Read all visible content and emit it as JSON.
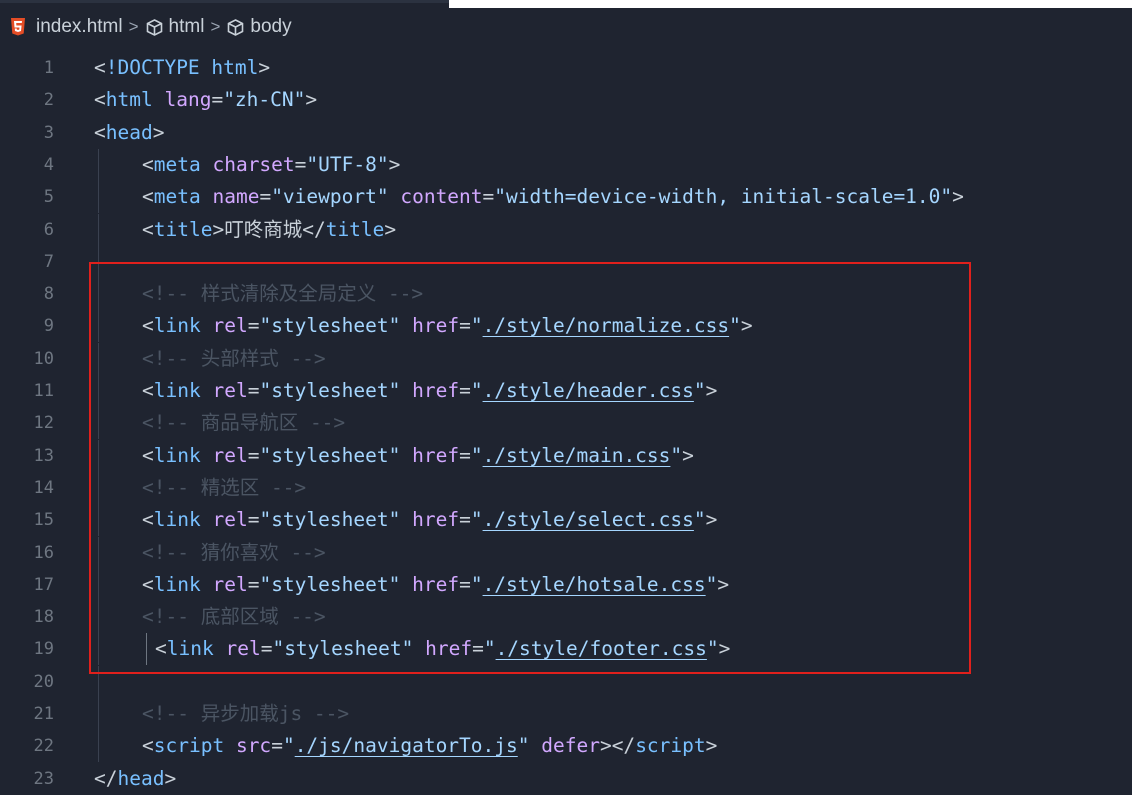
{
  "breadcrumb": {
    "file": "index.html",
    "items": [
      "html",
      "body"
    ],
    "separator": ">"
  },
  "lines": [
    {
      "n": "1",
      "indent": 0,
      "parts": [
        [
          "punc",
          "<"
        ],
        [
          "tag",
          "!DOCTYPE html"
        ],
        [
          "punc",
          ">"
        ]
      ]
    },
    {
      "n": "2",
      "indent": 0,
      "parts": [
        [
          "punc",
          "<"
        ],
        [
          "tag",
          "html"
        ],
        [
          "punc",
          " "
        ],
        [
          "attr",
          "lang"
        ],
        [
          "punc",
          "="
        ],
        [
          "str",
          "\"zh-CN\""
        ],
        [
          "punc",
          ">"
        ]
      ]
    },
    {
      "n": "3",
      "indent": 0,
      "parts": [
        [
          "punc",
          "<"
        ],
        [
          "tag",
          "head"
        ],
        [
          "punc",
          ">"
        ]
      ]
    },
    {
      "n": "4",
      "indent": 1,
      "parts": [
        [
          "punc",
          "<"
        ],
        [
          "tag",
          "meta"
        ],
        [
          "punc",
          " "
        ],
        [
          "attr",
          "charset"
        ],
        [
          "punc",
          "="
        ],
        [
          "str",
          "\"UTF-8\""
        ],
        [
          "punc",
          ">"
        ]
      ]
    },
    {
      "n": "5",
      "indent": 1,
      "parts": [
        [
          "punc",
          "<"
        ],
        [
          "tag",
          "meta"
        ],
        [
          "punc",
          " "
        ],
        [
          "attr",
          "name"
        ],
        [
          "punc",
          "="
        ],
        [
          "str",
          "\"viewport\""
        ],
        [
          "punc",
          " "
        ],
        [
          "attr",
          "content"
        ],
        [
          "punc",
          "="
        ],
        [
          "str",
          "\"width=device-width, initial-scale=1.0\""
        ],
        [
          "punc",
          ">"
        ]
      ]
    },
    {
      "n": "6",
      "indent": 1,
      "parts": [
        [
          "punc",
          "<"
        ],
        [
          "tag",
          "title"
        ],
        [
          "punc",
          ">"
        ],
        [
          "punc",
          "叮咚商城"
        ],
        [
          "punc",
          "</"
        ],
        [
          "tag",
          "title"
        ],
        [
          "punc",
          ">"
        ]
      ]
    },
    {
      "n": "7",
      "indent": 0,
      "parts": []
    },
    {
      "n": "8",
      "indent": 1,
      "parts": [
        [
          "comment",
          "<!-- 样式清除及全局定义 -->"
        ]
      ]
    },
    {
      "n": "9",
      "indent": 1,
      "parts": [
        [
          "punc",
          "<"
        ],
        [
          "tag",
          "link"
        ],
        [
          "punc",
          " "
        ],
        [
          "attr",
          "rel"
        ],
        [
          "punc",
          "="
        ],
        [
          "str",
          "\"stylesheet\""
        ],
        [
          "punc",
          " "
        ],
        [
          "attr",
          "href"
        ],
        [
          "punc",
          "="
        ],
        [
          "str",
          "\""
        ],
        [
          "link",
          "./style/normalize.css"
        ],
        [
          "str",
          "\""
        ],
        [
          "punc",
          ">"
        ]
      ]
    },
    {
      "n": "10",
      "indent": 1,
      "parts": [
        [
          "comment",
          "<!-- 头部样式 -->"
        ]
      ]
    },
    {
      "n": "11",
      "indent": 1,
      "parts": [
        [
          "punc",
          "<"
        ],
        [
          "tag",
          "link"
        ],
        [
          "punc",
          " "
        ],
        [
          "attr",
          "rel"
        ],
        [
          "punc",
          "="
        ],
        [
          "str",
          "\"stylesheet\""
        ],
        [
          "punc",
          " "
        ],
        [
          "attr",
          "href"
        ],
        [
          "punc",
          "="
        ],
        [
          "str",
          "\""
        ],
        [
          "link",
          "./style/header.css"
        ],
        [
          "str",
          "\""
        ],
        [
          "punc",
          ">"
        ]
      ]
    },
    {
      "n": "12",
      "indent": 1,
      "parts": [
        [
          "comment",
          "<!-- 商品导航区 -->"
        ]
      ]
    },
    {
      "n": "13",
      "indent": 1,
      "parts": [
        [
          "punc",
          "<"
        ],
        [
          "tag",
          "link"
        ],
        [
          "punc",
          " "
        ],
        [
          "attr",
          "rel"
        ],
        [
          "punc",
          "="
        ],
        [
          "str",
          "\"stylesheet\""
        ],
        [
          "punc",
          " "
        ],
        [
          "attr",
          "href"
        ],
        [
          "punc",
          "="
        ],
        [
          "str",
          "\""
        ],
        [
          "link",
          "./style/main.css"
        ],
        [
          "str",
          "\""
        ],
        [
          "punc",
          ">"
        ]
      ]
    },
    {
      "n": "14",
      "indent": 1,
      "parts": [
        [
          "comment",
          "<!-- 精选区 -->"
        ]
      ]
    },
    {
      "n": "15",
      "indent": 1,
      "parts": [
        [
          "punc",
          "<"
        ],
        [
          "tag",
          "link"
        ],
        [
          "punc",
          " "
        ],
        [
          "attr",
          "rel"
        ],
        [
          "punc",
          "="
        ],
        [
          "str",
          "\"stylesheet\""
        ],
        [
          "punc",
          " "
        ],
        [
          "attr",
          "href"
        ],
        [
          "punc",
          "="
        ],
        [
          "str",
          "\""
        ],
        [
          "link",
          "./style/select.css"
        ],
        [
          "str",
          "\""
        ],
        [
          "punc",
          ">"
        ]
      ]
    },
    {
      "n": "16",
      "indent": 1,
      "parts": [
        [
          "comment",
          "<!-- 猜你喜欢 -->"
        ]
      ]
    },
    {
      "n": "17",
      "indent": 1,
      "parts": [
        [
          "punc",
          "<"
        ],
        [
          "tag",
          "link"
        ],
        [
          "punc",
          " "
        ],
        [
          "attr",
          "rel"
        ],
        [
          "punc",
          "="
        ],
        [
          "str",
          "\"stylesheet\""
        ],
        [
          "punc",
          " "
        ],
        [
          "attr",
          "href"
        ],
        [
          "punc",
          "="
        ],
        [
          "str",
          "\""
        ],
        [
          "link",
          "./style/hotsale.css"
        ],
        [
          "str",
          "\""
        ],
        [
          "punc",
          ">"
        ]
      ]
    },
    {
      "n": "18",
      "indent": 1,
      "parts": [
        [
          "comment",
          "<!-- 底部区域 -->"
        ]
      ]
    },
    {
      "n": "19",
      "indent": 2,
      "parts": [
        [
          "punc",
          "<"
        ],
        [
          "tag",
          "link"
        ],
        [
          "punc",
          " "
        ],
        [
          "attr",
          "rel"
        ],
        [
          "punc",
          "="
        ],
        [
          "str",
          "\"stylesheet\""
        ],
        [
          "punc",
          " "
        ],
        [
          "attr",
          "href"
        ],
        [
          "punc",
          "="
        ],
        [
          "str",
          "\""
        ],
        [
          "link",
          "./style/footer.css"
        ],
        [
          "str",
          "\""
        ],
        [
          "punc",
          ">"
        ]
      ]
    },
    {
      "n": "20",
      "indent": 0,
      "parts": []
    },
    {
      "n": "21",
      "indent": 1,
      "parts": [
        [
          "comment",
          "<!-- 异步加载js -->"
        ]
      ]
    },
    {
      "n": "22",
      "indent": 1,
      "parts": [
        [
          "punc",
          "<"
        ],
        [
          "tag",
          "script"
        ],
        [
          "punc",
          " "
        ],
        [
          "attr",
          "src"
        ],
        [
          "punc",
          "="
        ],
        [
          "str",
          "\""
        ],
        [
          "link",
          "./js/navigatorTo.js"
        ],
        [
          "str",
          "\""
        ],
        [
          "punc",
          " "
        ],
        [
          "attr",
          "defer"
        ],
        [
          "punc",
          "></"
        ],
        [
          "tag",
          "script"
        ],
        [
          "punc",
          ">"
        ]
      ]
    },
    {
      "n": "23",
      "indent": 0,
      "parts": [
        [
          "punc",
          "</"
        ],
        [
          "tag",
          "head"
        ],
        [
          "punc",
          ">"
        ]
      ]
    }
  ]
}
